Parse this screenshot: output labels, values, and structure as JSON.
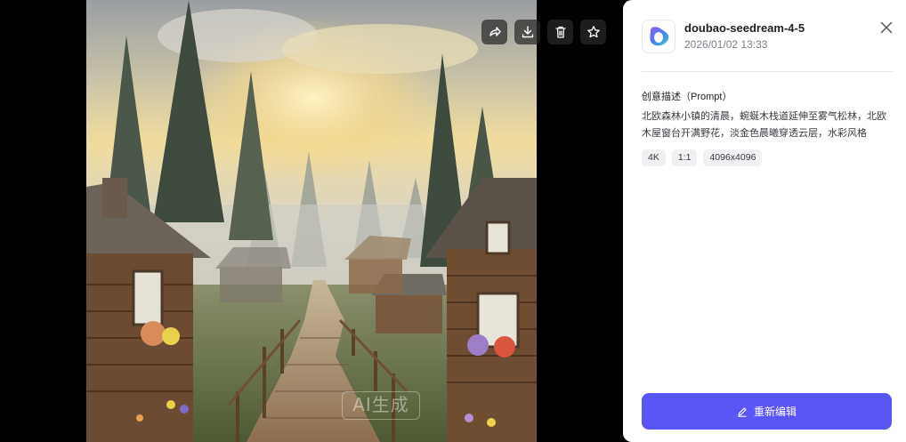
{
  "viewer": {
    "watermark": "AI生成",
    "toolbar": [
      {
        "name": "share-button",
        "icon": "share-icon"
      },
      {
        "name": "download-button",
        "icon": "download-icon"
      },
      {
        "name": "delete-button",
        "icon": "trash-icon"
      },
      {
        "name": "favorite-button",
        "icon": "star-icon"
      }
    ]
  },
  "panel": {
    "model_name": "doubao-seedream-4-5",
    "date": "2026/01/02 13:33",
    "section_title": "创意描述（Prompt）",
    "prompt": "北欧森林小镇的清晨，蜿蜒木栈道延伸至雾气松林，北欧木屋窗台开满野花，淡金色晨曦穿透云层，水彩风格",
    "tags": [
      "4K",
      "1:1",
      "4096x4096"
    ],
    "reedit_label": "重新编辑",
    "accent_color": "#5a55f5"
  }
}
